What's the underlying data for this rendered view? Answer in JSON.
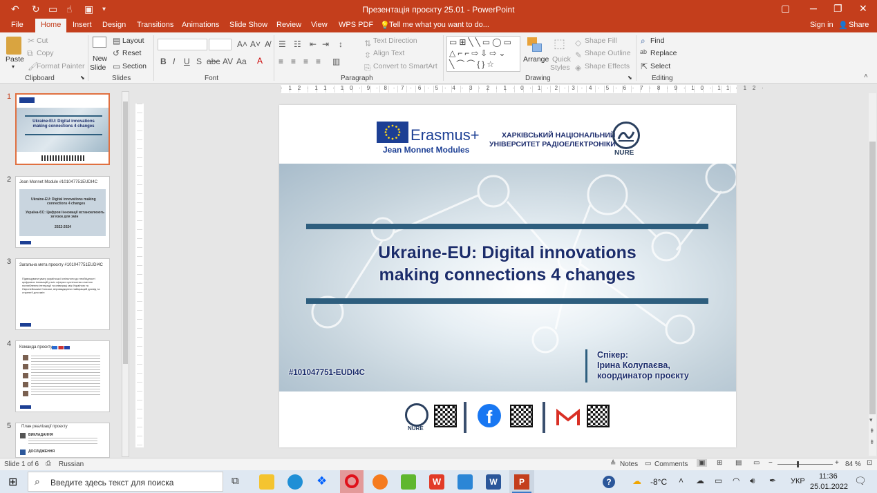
{
  "window": {
    "title": "Презентація проєкту 25.01 - PowerPoint"
  },
  "tabs": [
    "File",
    "Home",
    "Insert",
    "Design",
    "Transitions",
    "Animations",
    "Slide Show",
    "Review",
    "View",
    "WPS PDF"
  ],
  "tell_me": "Tell me what you want to do...",
  "account": {
    "sign_in": "Sign in",
    "share": "Share"
  },
  "ribbon": {
    "clipboard": {
      "paste": "Paste",
      "cut": "Cut",
      "copy": "Copy",
      "format_painter": "Format Painter",
      "label": "Clipboard"
    },
    "slides": {
      "new_slide": "New",
      "new_slide2": "Slide",
      "layout": "Layout",
      "reset": "Reset",
      "section": "Section",
      "label": "Slides"
    },
    "font": {
      "label": "Font"
    },
    "paragraph": {
      "text_direction": "Text Direction",
      "align_text": "Align Text",
      "smartart": "Convert to SmartArt",
      "label": "Paragraph"
    },
    "drawing": {
      "arrange": "Arrange",
      "quick_styles": "Quick",
      "quick_styles2": "Styles",
      "shape_fill": "Shape Fill",
      "shape_outline": "Shape Outline",
      "shape_effects": "Shape Effects",
      "label": "Drawing"
    },
    "editing": {
      "find": "Find",
      "replace": "Replace",
      "select": "Select",
      "label": "Editing"
    }
  },
  "thumbs": [
    {
      "n": "1"
    },
    {
      "n": "2",
      "title": "Jean Monnet Module  #101047751EUDI4C",
      "l1": "Ukraine-EU: Digital innovations making",
      "l2": "connections 4 changes",
      "l3": "Україна-ЄС: Цифрові інновації встановлюють",
      "l4": "зв’язки для змін",
      "year": "2022-2024"
    },
    {
      "n": "3",
      "title": "Загальна мета проєкту #101047751EUDI4C",
      "body": "Підвищувати увагу української спільноти до необхідності цифрових інновацій у всіх сферах суспільства з метою поглиблення інтеграції та співпраці між Україною та Європейським Союзом, впроваджуючи найкращий досвід та стратегії для змін"
    },
    {
      "n": "4",
      "title": "Команда проєкту"
    },
    {
      "n": "5",
      "title": "План реалізації проєкту",
      "s1": "ВИКЛАДАННЯ",
      "s2": "ДОСЛІДЖЕННЯ"
    }
  ],
  "slide": {
    "erasmus": "Erasmus+",
    "jean_monnet": "Jean Monnet Modules",
    "university1": "ХАРКІВСЬКИЙ НАЦІОНАЛЬНИЙ",
    "university2": "УНІВЕРСИТЕТ РАДІОЕЛЕКТРОНІКИ",
    "nure": "NURE",
    "title1": "Ukraine-EU: Digital innovations",
    "title2": "making connections 4 changes",
    "hashtag": "#101047751-EUDI4C",
    "speaker1": "Спікер:",
    "speaker2": "Ірина Колупаєва,",
    "speaker3": "координатор проєкту"
  },
  "status": {
    "slide": "Slide 1 of 6",
    "language": "Russian",
    "notes": "Notes",
    "comments": "Comments",
    "zoom": "84 %"
  },
  "taskbar": {
    "search": "Введите здесь текст для поиска",
    "temp": "-8°C",
    "lang": "УКР",
    "time": "11:36",
    "date": "25.01.2022"
  }
}
